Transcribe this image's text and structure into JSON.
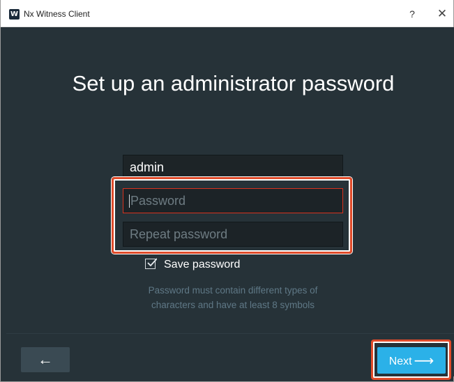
{
  "window": {
    "title": "Nx Witness Client",
    "logo_letter": "W",
    "help_label": "?",
    "close_label": "✕"
  },
  "setup": {
    "title": "Set up an administrator password",
    "login_value": "admin",
    "password_placeholder": "Password",
    "repeat_placeholder": "Repeat password",
    "save_password_label": "Save password",
    "save_password_checked": true,
    "hint_line1": "Password must contain different types of",
    "hint_line2": "characters and have at least 8 symbols"
  },
  "footer": {
    "back_label": "←",
    "next_label": "Next",
    "next_arrow": "⟶"
  },
  "colors": {
    "background": "#263238",
    "accent": "#2bb1e8",
    "highlight": "#e04b2a",
    "error_border": "#d8321e"
  }
}
